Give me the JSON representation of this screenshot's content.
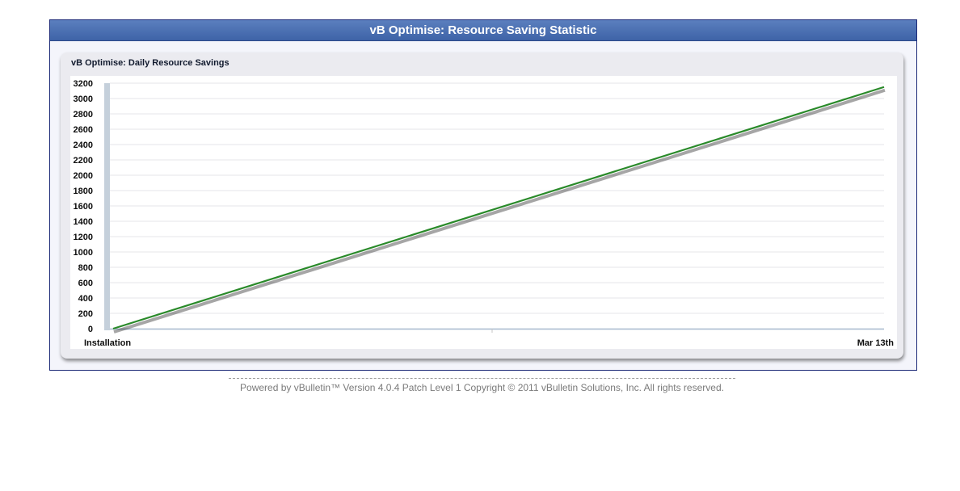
{
  "page": {
    "header_title": "vB Optimise: Resource Saving Statistic",
    "footer_text": "Powered by vBulletin™ Version 4.0.4 Patch Level 1 Copyright © 2011 vBulletin Solutions, Inc. All rights reserved."
  },
  "colors": {
    "header_bg": "#4a6db0",
    "line": "#2a8a2a",
    "axis_bar": "#c5d0db"
  },
  "chart_data": {
    "type": "line",
    "title": "vB Optimise: Daily Resource Savings",
    "xlabel": "",
    "ylabel": "",
    "x_tick_labels": [
      "Installation",
      "Mar 13th"
    ],
    "y_ticks": [
      0,
      200,
      400,
      600,
      800,
      1000,
      1200,
      1400,
      1600,
      1800,
      2000,
      2200,
      2400,
      2600,
      2800,
      3000,
      3200
    ],
    "ylim": [
      0,
      3200
    ],
    "grid": true,
    "series": [
      {
        "x": [
          0,
          1
        ],
        "values": [
          0,
          3150
        ]
      }
    ]
  }
}
